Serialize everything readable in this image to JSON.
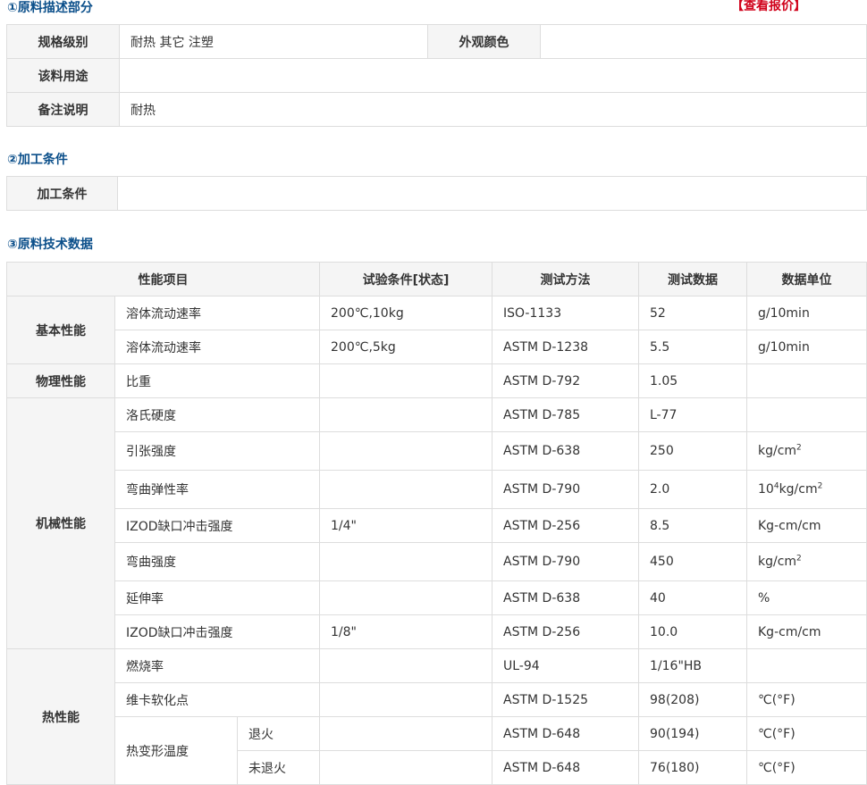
{
  "section1": {
    "title": "①原料描述部分",
    "quote_link": "【查看报价】",
    "rows": {
      "spec_label": "规格级别",
      "spec_value": "耐热 其它 注塑",
      "color_label": "外观颜色",
      "color_value": "",
      "usage_label": "该料用途",
      "usage_value": "",
      "notes_label": "备注说明",
      "notes_value": "耐热"
    }
  },
  "section2": {
    "title": "②加工条件",
    "label": "加工条件",
    "value": ""
  },
  "section3": {
    "title": "③原料技术数据",
    "headers": [
      "性能项目",
      "试验条件[状态]",
      "测试方法",
      "测试数据",
      "数据单位"
    ],
    "categories": {
      "basic": "基本性能",
      "physical": "物理性能",
      "mechanical": "机械性能",
      "thermal": "热性能"
    },
    "rows": [
      {
        "item": "溶体流动速率",
        "cond": "200℃,10kg",
        "method": "ISO-1133",
        "value": "52",
        "unit": "g/10min"
      },
      {
        "item": "溶体流动速率",
        "cond": "200℃,5kg",
        "method": "ASTM D-1238",
        "value": "5.5",
        "unit": "g/10min"
      },
      {
        "item": "比重",
        "cond": "",
        "method": "ASTM D-792",
        "value": "1.05",
        "unit": ""
      },
      {
        "item": "洛氏硬度",
        "cond": "",
        "method": "ASTM D-785",
        "value": "L-77",
        "unit": ""
      },
      {
        "item": "引张强度",
        "cond": "",
        "method": "ASTM D-638",
        "value": "250",
        "unit": "kg/cm",
        "unit_sup": "2"
      },
      {
        "item": "弯曲弹性率",
        "cond": "",
        "method": "ASTM D-790",
        "value": "2.0",
        "unit_pre": "10",
        "unit_pre_sup": "4",
        "unit": "kg/cm",
        "unit_sup": "2"
      },
      {
        "item": "IZOD缺口冲击强度",
        "cond": "1/4\"",
        "method": "ASTM D-256",
        "value": "8.5",
        "unit": "Kg-cm/cm"
      },
      {
        "item": "弯曲强度",
        "cond": "",
        "method": "ASTM D-790",
        "value": "450",
        "unit": "kg/cm",
        "unit_sup": "2"
      },
      {
        "item": "延伸率",
        "cond": "",
        "method": "ASTM D-638",
        "value": "40",
        "unit": "%"
      },
      {
        "item": "IZOD缺口冲击强度",
        "cond": "1/8\"",
        "method": "ASTM D-256",
        "value": "10.0",
        "unit": "Kg-cm/cm"
      },
      {
        "item": "燃烧率",
        "cond": "",
        "method": "UL-94",
        "value": "1/16\"HB",
        "unit": ""
      },
      {
        "item": "维卡软化点",
        "cond": "",
        "method": "ASTM D-1525",
        "value": "98(208)",
        "unit": "℃(°F)"
      },
      {
        "item": "热变形温度",
        "sub": "退火",
        "cond": "",
        "method": "ASTM D-648",
        "value": "90(194)",
        "unit": "℃(°F)"
      },
      {
        "sub": "未退火",
        "cond": "",
        "method": "ASTM D-648",
        "value": "76(180)",
        "unit": "℃(°F)"
      }
    ]
  }
}
